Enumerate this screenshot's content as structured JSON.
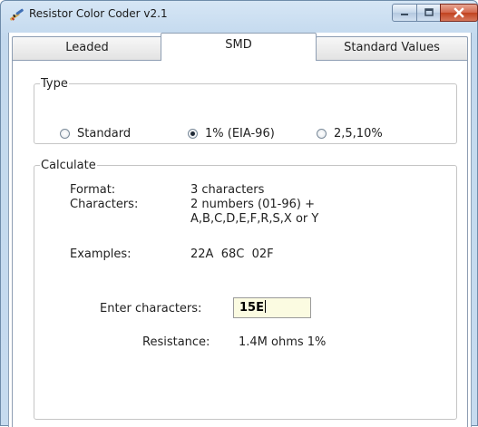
{
  "window": {
    "title": "Resistor Color Coder v2.1",
    "icons": {
      "app": "resistor-pen-icon",
      "minimize": "minimize-icon",
      "maximize": "maximize-icon",
      "close": "close-icon"
    },
    "close_color": "#c9482a"
  },
  "tabs": [
    {
      "label": "Leaded",
      "selected": false
    },
    {
      "label": "SMD",
      "selected": true
    },
    {
      "label": "Standard Values",
      "selected": false
    }
  ],
  "type_group": {
    "legend": "Type",
    "options": [
      {
        "label": "Standard",
        "selected": false
      },
      {
        "label": "1% (EIA-96)",
        "selected": true
      },
      {
        "label": "2,5,10%",
        "selected": false
      }
    ]
  },
  "calculate_group": {
    "legend": "Calculate",
    "format_label": "Format:",
    "format_value": "3 characters",
    "characters_label": "Characters:",
    "characters_value_line1": "2 numbers (01-96) +",
    "characters_value_line2": "A,B,C,D,E,F,R,S,X or Y",
    "examples_label": "Examples:",
    "examples_value": "22A  68C  02F",
    "enter_label": "Enter characters:",
    "enter_value": "15E",
    "resistance_label": "Resistance:",
    "resistance_value": "1.4M ohms 1%"
  },
  "colors": {
    "input_background": "#fbfbe1",
    "titlebar": "#c3d9ee"
  }
}
